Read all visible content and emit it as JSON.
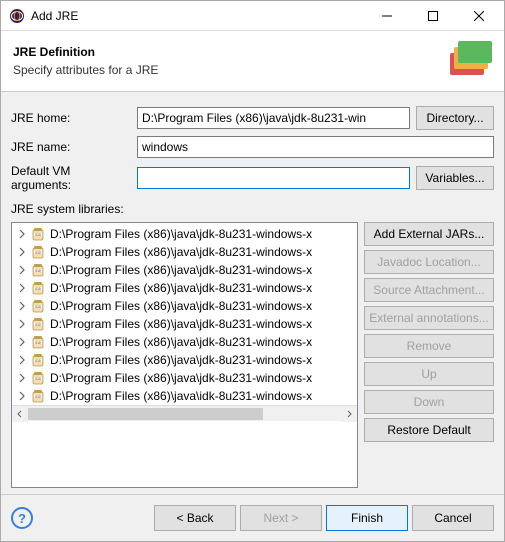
{
  "titlebar": {
    "title": "Add JRE"
  },
  "header": {
    "title": "JRE Definition",
    "subtitle": "Specify attributes for a JRE"
  },
  "fields": {
    "jre_home_label": "JRE home:",
    "jre_home_value": "D:\\Program Files (x86)\\java\\jdk-8u231-win",
    "directory_btn": "Directory...",
    "jre_name_label": "JRE name:",
    "jre_name_value": "windows",
    "vm_args_label": "Default VM arguments:",
    "vm_args_value": "",
    "variables_btn": "Variables..."
  },
  "sys_libs": {
    "label": "JRE system libraries:",
    "items": [
      "D:\\Program Files (x86)\\java\\jdk-8u231-windows-x",
      "D:\\Program Files (x86)\\java\\jdk-8u231-windows-x",
      "D:\\Program Files (x86)\\java\\jdk-8u231-windows-x",
      "D:\\Program Files (x86)\\java\\jdk-8u231-windows-x",
      "D:\\Program Files (x86)\\java\\jdk-8u231-windows-x",
      "D:\\Program Files (x86)\\java\\jdk-8u231-windows-x",
      "D:\\Program Files (x86)\\java\\jdk-8u231-windows-x",
      "D:\\Program Files (x86)\\java\\jdk-8u231-windows-x",
      "D:\\Program Files (x86)\\java\\jdk-8u231-windows-x",
      "D:\\Program Files (x86)\\java\\idk-8u231-windows-x"
    ],
    "buttons": {
      "add_external": "Add External JARs...",
      "javadoc": "Javadoc Location...",
      "source": "Source Attachment...",
      "external_ann": "External annotations...",
      "remove": "Remove",
      "up": "Up",
      "down": "Down",
      "restore": "Restore Default"
    }
  },
  "footer": {
    "back": "< Back",
    "next": "Next >",
    "finish": "Finish",
    "cancel": "Cancel"
  }
}
